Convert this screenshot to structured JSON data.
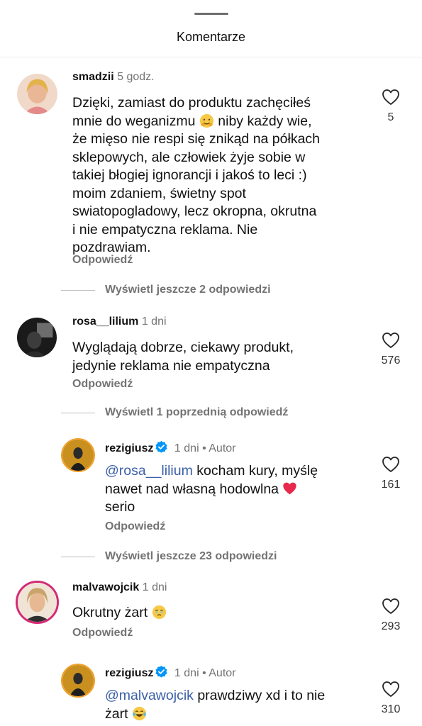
{
  "sheet": {
    "title": "Komentarze"
  },
  "comments": [
    {
      "username": "smadzii",
      "time": "5 godz.",
      "lines": [
        "Dzięki, zamiast do produktu zachęciłeś",
        "mnie do weganizmu",
        "że mięso nie respi się znikąd na półkach",
        "sklepowych, ale człowiek żyje sobie w",
        "takiej błogiej ignorancji i jakoś to leci :)",
        "moim zdaniem, świetny spot",
        "swiatopogladowy, lecz okropna, okrutna",
        "i nie empatyczna reklama.  Nie",
        "pozdrawiam."
      ],
      "line2_after_emoji": "niby każdy wie,",
      "reply_label": "Odpowiedź",
      "likes": "5",
      "view_more": "Wyświetl jeszcze 2 odpowiedzi"
    },
    {
      "username": "rosa__lilium",
      "time": "1 dni",
      "lines": [
        "Wyglądają dobrze, ciekawy produkt,",
        "jedynie reklama nie empatyczna"
      ],
      "reply_label": "Odpowiedź",
      "likes": "576",
      "view_more": "Wyświetl 1 poprzednią odpowiedź"
    },
    {
      "username": "rezigiusz",
      "time": "1 dni",
      "author_tag": "• Autor",
      "mention": "@rosa__lilium",
      "line1_rest": " kocham kury, myślę",
      "line2": "nawet nad własną hodowlna",
      "line3": "serio",
      "reply_label": "Odpowiedź",
      "likes": "161",
      "view_more": "Wyświetl jeszcze 23 odpowiedzi"
    },
    {
      "username": "malvawojcik",
      "time": "1 dni",
      "text": "Okrutny żart",
      "reply_label": "Odpowiedź",
      "likes": "293"
    },
    {
      "username": "rezigiusz",
      "time": "1 dni",
      "author_tag": "• Autor",
      "mention": "@malvawojcik",
      "line1_rest": " prawdziwy xd i to nie",
      "line2": "żart",
      "likes": "310"
    }
  ],
  "icons": {
    "like": "heart-outline-icon",
    "verified": "verified-badge-icon",
    "accent_color": "#0095f6",
    "mention_color": "#3b5fa8",
    "heart_emoji_color": "#e8294c"
  }
}
